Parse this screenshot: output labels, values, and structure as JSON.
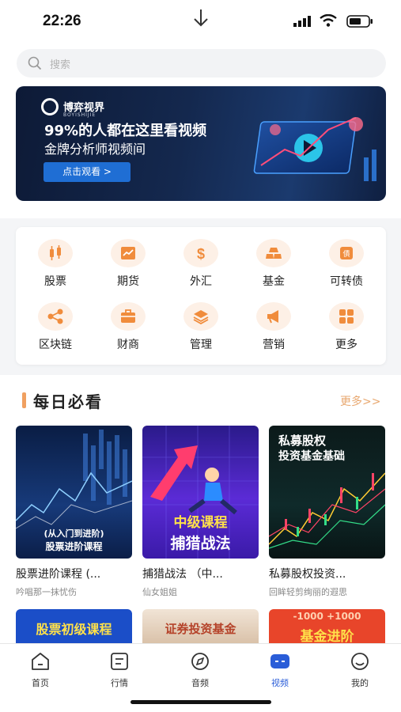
{
  "status": {
    "time": "22:26"
  },
  "search": {
    "placeholder": "搜索"
  },
  "banner": {
    "brand": "博弈视界",
    "brand_sub": "BOYISHIJIE",
    "title": "99%的人都在这里看视频",
    "subtitle": "金牌分析师视频间",
    "button": "点击观看 >",
    "dots": 6,
    "active_dot": 0
  },
  "categories": [
    {
      "label": "股票",
      "icon": "candlestick-icon"
    },
    {
      "label": "期货",
      "icon": "trend-chart-icon"
    },
    {
      "label": "外汇",
      "icon": "dollar-icon"
    },
    {
      "label": "基金",
      "icon": "gold-bars-icon"
    },
    {
      "label": "可转债",
      "icon": "bond-icon"
    },
    {
      "label": "区块链",
      "icon": "share-nodes-icon"
    },
    {
      "label": "财商",
      "icon": "briefcase-icon"
    },
    {
      "label": "管理",
      "icon": "layers-icon"
    },
    {
      "label": "营销",
      "icon": "megaphone-icon"
    },
    {
      "label": "更多",
      "icon": "grid-icon"
    }
  ],
  "daily": {
    "title": "每日必看",
    "more": "更多>>",
    "items": [
      {
        "title": "股票进阶课程 (...",
        "author": "吟唱那一抹忧伤",
        "thumb_text": "(从入门到进阶)",
        "thumb_text2": "股票进阶课程"
      },
      {
        "title": "捕猎战法 （中...",
        "author": "仙女姐姐",
        "thumb_text": "中级课程",
        "thumb_text2": "捕猎战法"
      },
      {
        "title": "私募股权投资...",
        "author": "回眸轻剪绚丽的遐思",
        "thumb_text": "私募股权",
        "thumb_text2": "投资基金基础"
      }
    ],
    "row2": [
      {
        "thumb_text": "股票初级课程"
      },
      {
        "thumb_text": "证券投资基金"
      },
      {
        "thumb_text": "基金进阶",
        "thumb_text2": "-1000  +1000"
      }
    ]
  },
  "tabbar": [
    {
      "label": "首页",
      "icon": "home-icon"
    },
    {
      "label": "行情",
      "icon": "quotes-icon"
    },
    {
      "label": "音频",
      "icon": "compass-icon"
    },
    {
      "label": "视频",
      "icon": "video-icon",
      "active": true
    },
    {
      "label": "我的",
      "icon": "smile-icon"
    }
  ],
  "colors": {
    "accent": "#f08c3c",
    "tab_active": "#2a5dd8",
    "banner_btn": "#1f6ed4"
  }
}
